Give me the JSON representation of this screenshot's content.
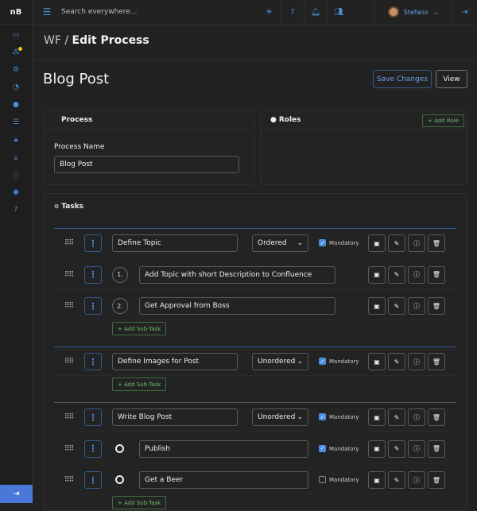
{
  "sidebar": {
    "logo": "nB",
    "icons": [
      "monitor-icon",
      "users-icon",
      "cogs-icon",
      "history-icon",
      "circle-icon",
      "list-icon",
      "lock-icon",
      "plug-icon",
      "info-icon",
      "target-icon",
      "help-icon"
    ],
    "logout": "logout-icon"
  },
  "topbar": {
    "search_placeholder": "Search everywhere...",
    "user": "Stefano"
  },
  "breadcrumb": {
    "root": "WF",
    "sep": "/",
    "current": "Edit Process"
  },
  "page": {
    "title": "Blog Post",
    "save": "Save Changes",
    "view": "View"
  },
  "process": {
    "header": "Process",
    "name_label": "Process Name",
    "name_value": "Blog Post"
  },
  "roles": {
    "header": "Roles",
    "add": "+ Add Role"
  },
  "tasks": {
    "header": "Tasks",
    "add_subtask": "+ Add Sub-Task",
    "mandatory": "Mandatory",
    "groups": [
      {
        "name": "Define Topic",
        "type": "Ordered",
        "mandatory": true,
        "subtasks": [
          {
            "marker": "1.",
            "name": "Add Topic with short Description to Confluence"
          },
          {
            "marker": "2.",
            "name": "Get Approval from Boss"
          }
        ]
      },
      {
        "name": "Define Images for Post",
        "type": "Unordered",
        "mandatory": true,
        "subtasks": []
      },
      {
        "name": "Write Blog Post",
        "type": "Unordered",
        "mandatory": true,
        "subtasks": [
          {
            "marker": "",
            "name": "Publish",
            "mandatory": true
          },
          {
            "marker": "",
            "name": "Get a Beer",
            "mandatory": false
          }
        ]
      }
    ]
  },
  "colors": {
    "accent": "#4a8fe0",
    "success": "#6bbf6b",
    "bg": "#222222"
  }
}
